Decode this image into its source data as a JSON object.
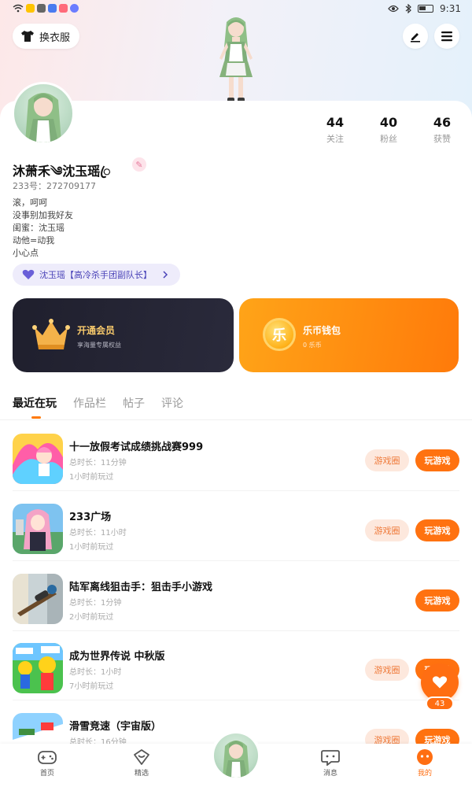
{
  "status_bar": {
    "time": "9:31"
  },
  "header": {
    "outfit_label": "换衣服"
  },
  "profile": {
    "nickname": "沐萧禾༄沈玉瑶ꦿ",
    "uid": "233号：272709177",
    "bio": [
      "滚，呵呵",
      "没事别加我好友",
      "闺蜜：沈玉瑶",
      "动他=动我",
      "小心点"
    ],
    "team_tag": "沈玉瑶【高冷杀手团副队长】",
    "stats": [
      {
        "value": "44",
        "label": "关注"
      },
      {
        "value": "40",
        "label": "粉丝"
      },
      {
        "value": "46",
        "label": "获赞"
      }
    ]
  },
  "promos": {
    "vip": {
      "title": "开通会员",
      "subtitle": "享海量专属权益"
    },
    "wallet": {
      "title": "乐币钱包",
      "subtitle": "0 乐币",
      "icon_text": "乐"
    }
  },
  "tabs": [
    "最近在玩",
    "作品栏",
    "帖子",
    "评论"
  ],
  "games": [
    {
      "title": "十一放假考试成绩挑战赛999",
      "duration": "总时长：11分钟",
      "last_played": "1小时前玩过",
      "circle": "游戏圈",
      "play": "玩游戏"
    },
    {
      "title": "233广场",
      "duration": "总时长：11小时",
      "last_played": "1小时前玩过",
      "circle": "游戏圈",
      "play": "玩游戏"
    },
    {
      "title": "陆军离线狙击手：狙击手小游戏",
      "duration": "总时长：1分钟",
      "last_played": "2小时前玩过",
      "circle": null,
      "play": "玩游戏"
    },
    {
      "title": "成为世界传说 中秋版",
      "duration": "总时长：1小时",
      "last_played": "7小时前玩过",
      "circle": "游戏圈",
      "play": "玩游戏"
    },
    {
      "title": "滑雪竞速（宇宙版）",
      "duration": "总时长：16分钟",
      "last_played": "",
      "circle": "游戏圈",
      "play": "玩游戏"
    }
  ],
  "favorite": {
    "count": "43"
  },
  "bottom_nav": [
    "首页",
    "精选",
    "消息",
    "我的"
  ],
  "colors": {
    "accent": "#ff7210",
    "vip_bg": "#23232f",
    "wallet_bg": "#ff8c10",
    "tag_bg": "#eeecfb"
  }
}
